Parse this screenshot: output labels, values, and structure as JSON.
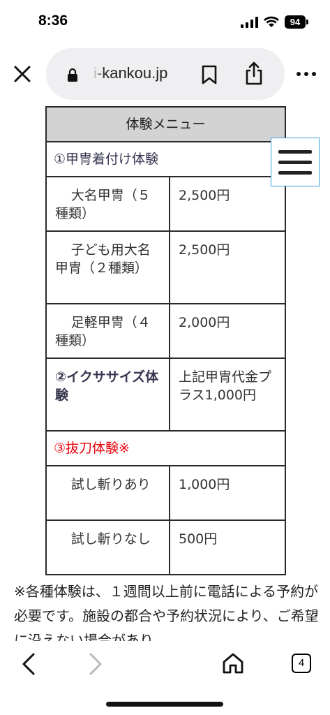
{
  "status_bar": {
    "time": "8:36",
    "battery": "94"
  },
  "browser": {
    "url": "i-kankou.jp",
    "tab_count": "4"
  },
  "menu_table": {
    "header": "体験メニュー",
    "section1": {
      "title": "①甲冑着付け体験",
      "rows": [
        {
          "item": "大名甲冑（５種類）",
          "price": "2,500円"
        },
        {
          "item": "子ども用大名甲冑（２種類）",
          "price": "2,500円"
        },
        {
          "item": "足軽甲冑（４種類）",
          "price": "2,000円"
        }
      ]
    },
    "section2": {
      "title": "②イクササイズ体験",
      "price": "上記甲冑代金プラス1,000円"
    },
    "section3": {
      "title": "③抜刀体験※",
      "title_color": "#e8000b",
      "rows": [
        {
          "item": "試し斬りあり",
          "price": "1,000円"
        },
        {
          "item": "試し斬りなし",
          "price": "500円"
        }
      ]
    }
  },
  "note": "※各種体験は、１週間以上前に電話による予約が必要です。施設の都合や予約状況により、ご希望に沿えない場合があり"
}
